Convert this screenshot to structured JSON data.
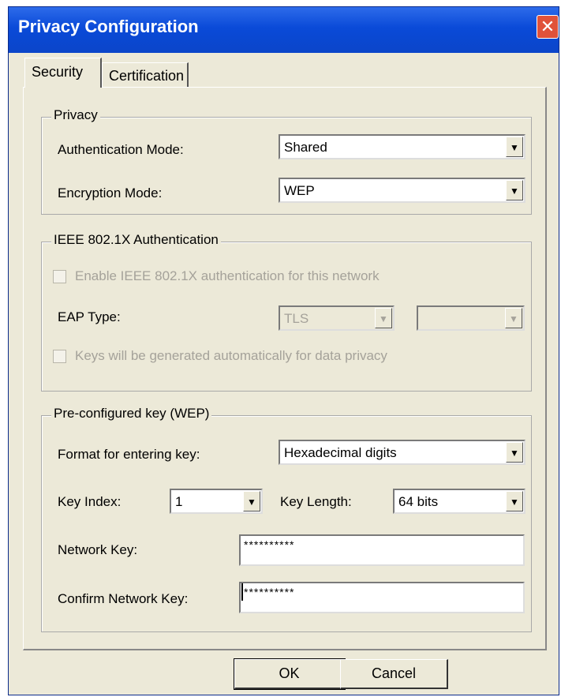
{
  "window": {
    "title": "Privacy Configuration",
    "close_glyph": "✕"
  },
  "tabs": [
    {
      "label": "Security",
      "active": true
    },
    {
      "label": "Certification",
      "active": false
    }
  ],
  "privacy": {
    "legend": "Privacy",
    "auth_mode_label": "Authentication Mode:",
    "auth_mode_value": "Shared",
    "enc_mode_label": "Encryption Mode:",
    "enc_mode_value": "WEP"
  },
  "ieee": {
    "legend": "IEEE 802.1X Authentication",
    "enable_label": "Enable IEEE 802.1X authentication for this network",
    "eap_label": "EAP Type:",
    "eap_value": "TLS",
    "eap_second_value": "",
    "keys_label": "Keys will be generated automatically for data privacy"
  },
  "wep": {
    "legend": "Pre-configured key (WEP)",
    "format_label": "Format for entering key:",
    "format_value": "Hexadecimal digits",
    "key_index_label": "Key Index:",
    "key_index_value": "1",
    "key_length_label": "Key Length:",
    "key_length_value": "64 bits",
    "network_key_label": "Network Key:",
    "network_key_value": "**********",
    "confirm_key_label": "Confirm Network Key:",
    "confirm_key_value": "**********"
  },
  "buttons": {
    "ok": "OK",
    "cancel": "Cancel"
  }
}
